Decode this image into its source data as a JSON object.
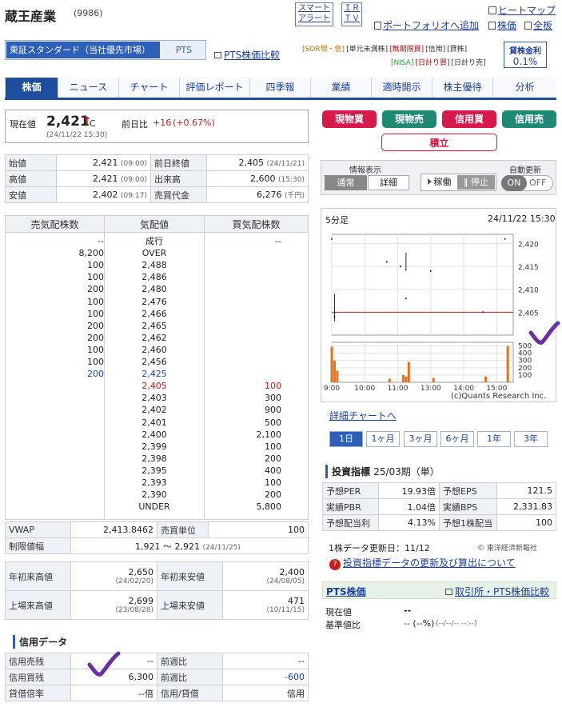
{
  "header": {
    "company": "蔵王産業",
    "code": "(9986)",
    "smart_alert": [
      "スマート",
      "アラート"
    ],
    "irtv": [
      "ＩＲ",
      "ＴＶ"
    ],
    "portfolio_add": "ポートフォリオへ追加",
    "heatmap": "ヒートマップ",
    "stock_price": "株価",
    "full_board": "全板"
  },
  "market": {
    "selected": "東証スタンダード（当社優先市場）",
    "pts": "PTS",
    "pts_compare": "PTS株価比較"
  },
  "badges": {
    "row1": [
      "[SOR現・信]",
      "[単元未満株]",
      "[無期限買]",
      "[信用]",
      "[貸株]"
    ],
    "row2": [
      "[NISA]",
      "[日計り買]",
      "[日計り売]"
    ],
    "lending_rate_label": "貸株金利",
    "lending_rate": "0.1%"
  },
  "tabs": [
    "株価",
    "ニュース",
    "チャート",
    "評価レポート",
    "四季報",
    "業績",
    "適時開示",
    "株主優待",
    "分析"
  ],
  "price": {
    "label": "現在値",
    "value": "2,421",
    "arrow": "↑",
    "suffix": "C",
    "time": "(24/11/22 15:30)",
    "change_label": "前日比",
    "change": "+16",
    "change_pct": "(+0.67%)"
  },
  "trade_buttons": {
    "spot_buy": "現物買",
    "spot_sell": "現物売",
    "margin_buy": "信用買",
    "margin_sell": "信用売",
    "accumulate": "積立"
  },
  "ohlc": {
    "rows": [
      {
        "l1": "始値",
        "v1": "2,421",
        "t1": "(09:00)",
        "l2": "前日終値",
        "v2": "2,405",
        "t2": "(24/11/21)"
      },
      {
        "l1": "高値",
        "v1": "2,421",
        "t1": "(09:00)",
        "l2": "出来高",
        "v2": "2,600",
        "t2": "(15:30)"
      },
      {
        "l1": "安値",
        "v1": "2,402",
        "t1": "(09:17)",
        "l2": "売買代金",
        "v2": "6,276",
        "t2": "(千円)"
      }
    ]
  },
  "info_display": {
    "label": "情報表示",
    "normal": "通常",
    "detail": "詳細"
  },
  "auto_update": {
    "label": "自動更新",
    "running": "稼働",
    "stop": "停止",
    "on": "ON",
    "off": "OFF"
  },
  "orderbook": {
    "headers": [
      "売気配株数",
      "気配値",
      "買気配株数"
    ],
    "rows": [
      {
        "ask": "--",
        "price": "成行",
        "bid": "--"
      },
      {
        "ask": "8,200",
        "price": "OVER",
        "bid": ""
      },
      {
        "ask": "100",
        "price": "2,488",
        "bid": ""
      },
      {
        "ask": "100",
        "price": "2,486",
        "bid": ""
      },
      {
        "ask": "200",
        "price": "2,480",
        "bid": ""
      },
      {
        "ask": "100",
        "price": "2,476",
        "bid": ""
      },
      {
        "ask": "100",
        "price": "2,466",
        "bid": ""
      },
      {
        "ask": "200",
        "price": "2,465",
        "bid": ""
      },
      {
        "ask": "200",
        "price": "2,462",
        "bid": ""
      },
      {
        "ask": "100",
        "price": "2,460",
        "bid": ""
      },
      {
        "ask": "100",
        "price": "2,456",
        "bid": ""
      },
      {
        "ask": "200",
        "price": "2,425",
        "bid": "",
        "color": "#1a3fd0"
      },
      {
        "ask": "",
        "price": "2,405",
        "bid": "100",
        "color": "#d01a1a"
      },
      {
        "ask": "",
        "price": "2,403",
        "bid": "300"
      },
      {
        "ask": "",
        "price": "2,402",
        "bid": "900"
      },
      {
        "ask": "",
        "price": "2,401",
        "bid": "500"
      },
      {
        "ask": "",
        "price": "2,400",
        "bid": "2,100"
      },
      {
        "ask": "",
        "price": "2,399",
        "bid": "100"
      },
      {
        "ask": "",
        "price": "2,398",
        "bid": "200"
      },
      {
        "ask": "",
        "price": "2,395",
        "bid": "400"
      },
      {
        "ask": "",
        "price": "2,393",
        "bid": "100"
      },
      {
        "ask": "",
        "price": "2,390",
        "bid": "200"
      },
      {
        "ask": "",
        "price": "UNDER",
        "bid": "5,800"
      }
    ]
  },
  "chart": {
    "interval": "5分足",
    "datetime": "24/11/22 15:30",
    "credit": "(c)Quants Research Inc.",
    "detail_link": "詳細チャートへ",
    "ranges": [
      "1日",
      "1ヶ月",
      "3ヶ月",
      "6ヶ月",
      "1年",
      "3年"
    ],
    "active_range": "1日"
  },
  "chart_data": {
    "type": "line",
    "title": "5分足",
    "price_ticks": [
      "2,420",
      "2,415",
      "2,410",
      "2,405"
    ],
    "volume_ticks": [
      "500",
      "400",
      "300",
      "200",
      "100"
    ],
    "x_ticks": [
      "9:00",
      "10:00",
      "11:00",
      "13:00",
      "14:00",
      "15:00"
    ],
    "ylim": [
      2400,
      2422
    ],
    "prev_close": 2405,
    "price_points": [
      {
        "t": "09:00",
        "v": 2421
      },
      {
        "t": "09:05",
        "v": 2404
      },
      {
        "t": "10:40",
        "v": 2416
      },
      {
        "t": "11:05",
        "v": 2415
      },
      {
        "t": "11:15",
        "v": 2408
      },
      {
        "t": "13:00",
        "v": 2414
      },
      {
        "t": "14:35",
        "v": 2405
      },
      {
        "t": "15:15",
        "v": 2421
      }
    ],
    "volume": [
      {
        "t": "09:00",
        "v": 490
      },
      {
        "t": "09:05",
        "v": 300
      },
      {
        "t": "09:10",
        "v": 160
      },
      {
        "t": "10:45",
        "v": 50
      },
      {
        "t": "11:10",
        "v": 100
      },
      {
        "t": "11:15",
        "v": 80
      },
      {
        "t": "11:20",
        "v": 280
      },
      {
        "t": "13:05",
        "v": 60
      },
      {
        "t": "14:40",
        "v": 80
      },
      {
        "t": "15:20",
        "v": 500
      }
    ]
  },
  "vwap": {
    "label": "VWAP",
    "value": "2,413.8462",
    "unit_label": "売買単位",
    "unit": "100"
  },
  "limit": {
    "label": "制限値幅",
    "value": "1,921 〜 2,921",
    "date": "(24/11/25)"
  },
  "highs_lows": [
    {
      "l1": "年初来高値",
      "v1": "2,650",
      "d1": "(24/02/20)",
      "l2": "年初来安値",
      "v2": "2,400",
      "d2": "(24/08/05)"
    },
    {
      "l1": "上場来高値",
      "v1": "2,699",
      "d1": "(23/08/28)",
      "l2": "上場来安値",
      "v2": "471",
      "d2": "(10/11/15)"
    }
  ],
  "credit": {
    "title": "信用データ",
    "rows": [
      {
        "l1": "信用売残",
        "v1": "--",
        "l2": "前週比",
        "v2": "--"
      },
      {
        "l1": "信用買残",
        "v1": "6,300",
        "l2": "前週比",
        "v2": "-600"
      },
      {
        "l1": "貸借倍率",
        "v1": "--倍",
        "l2": "信用/貸借",
        "v2": "信用"
      }
    ]
  },
  "indicators": {
    "title": "投資指標",
    "period": "25/03期（単）",
    "rows": [
      {
        "l1": "予想PER",
        "v1": "19.93倍",
        "l2": "予想EPS",
        "v2": "121.5"
      },
      {
        "l1": "実績PBR",
        "v1": "1.04倍",
        "l2": "実績BPS",
        "v2": "2,331.83"
      },
      {
        "l1": "予想配当利",
        "v1": "4.13%",
        "l2": "予想1株配当",
        "v2": "100"
      }
    ],
    "updated": "1株データ更新日：11/12",
    "source": "© 東洋経済新報社",
    "about_link": "投資指標データの更新及び算出について"
  },
  "pts": {
    "title": "PTS株価",
    "compare_link": "取引所・PTS株価比較",
    "current_label": "現在値",
    "current": "--",
    "base_label": "基準値比",
    "base": "-- (--%)",
    "base_time": "(--/--/-- --:--)"
  },
  "colors": {
    "accent": "#1e4f9e",
    "red_btn": "#d8194b",
    "green_btn": "#1f8a74",
    "accumulate": "#e0123a",
    "volume": "#e8701a",
    "prev_close_line": "#d01a1a"
  }
}
